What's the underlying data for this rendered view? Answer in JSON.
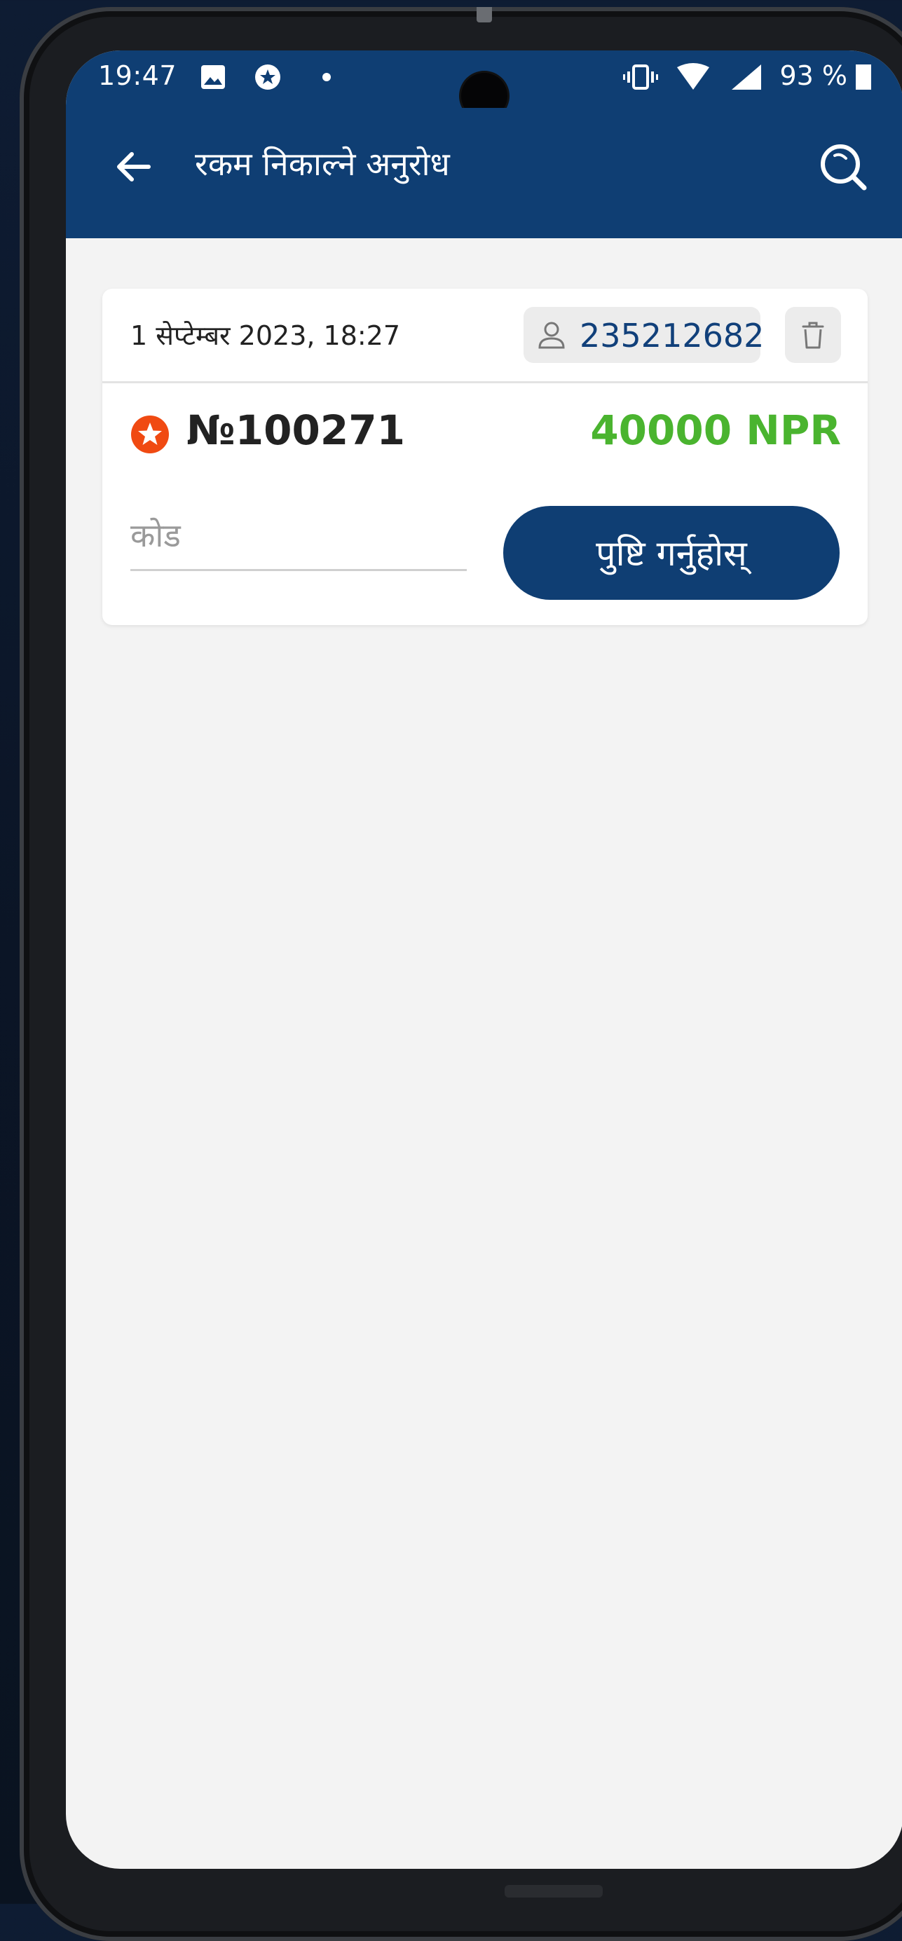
{
  "status_bar": {
    "time": "19:47",
    "battery_text": "93 %",
    "icons": [
      "gallery-icon",
      "star-badge-icon",
      "dot-icon",
      "vibrate-icon",
      "wifi-icon",
      "signal-icon",
      "battery-icon"
    ]
  },
  "app_bar": {
    "title": "रकम निकाल्ने अनुरोध",
    "back_icon": "arrow-left-icon",
    "search_icon": "search-icon"
  },
  "request_card": {
    "date": "1 सेप्टेम्बर 2023, 18:27",
    "user_id": "235212682",
    "request_number": "№100271",
    "amount": "40000 NPR",
    "code_placeholder": "कोड",
    "code_value": "",
    "confirm_label": "पुष्टि गर्नुहोस्"
  },
  "colors": {
    "primary": "#0f3e73",
    "amount_green": "#4ab42f",
    "badge_orange": "#f04a12",
    "background": "#f3f3f3"
  }
}
